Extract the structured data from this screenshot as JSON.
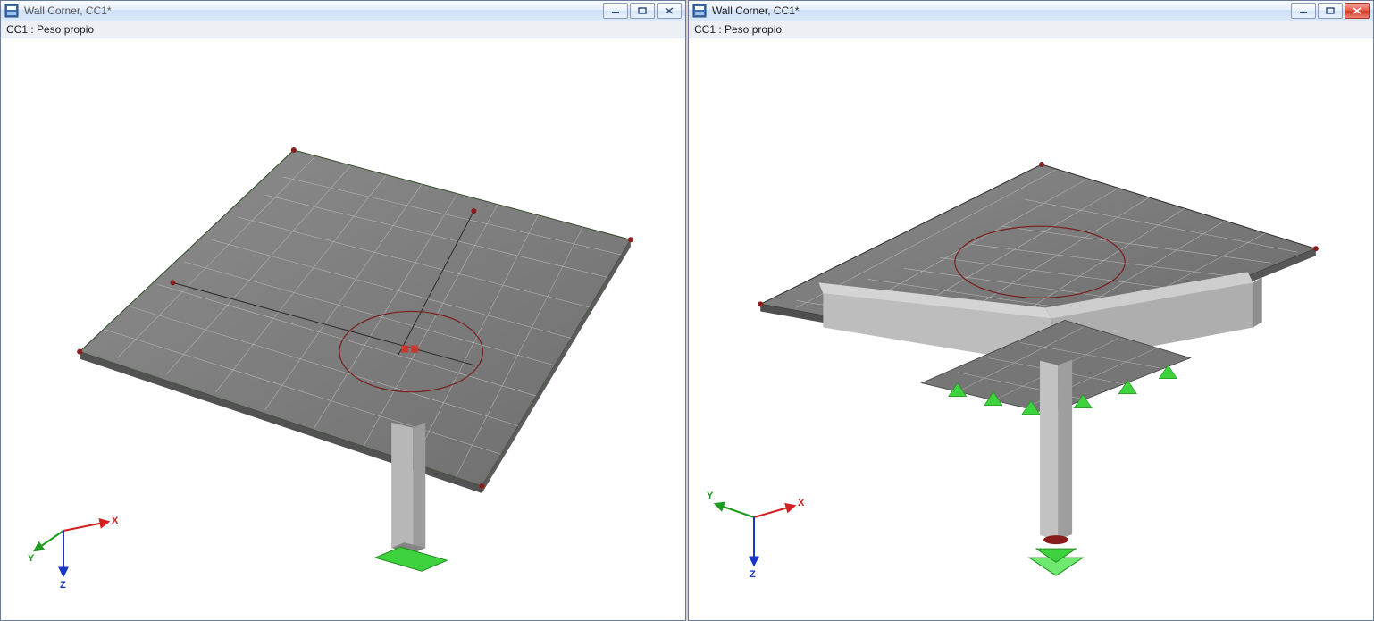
{
  "leftWindow": {
    "title": "Wall Corner, CC1*",
    "subheader": "CC1 : Peso propio"
  },
  "rightWindow": {
    "title": "Wall Corner, CC1*",
    "subheader": "CC1 : Peso propio"
  },
  "axes": {
    "x": "X",
    "y": "Y",
    "z": "Z"
  }
}
